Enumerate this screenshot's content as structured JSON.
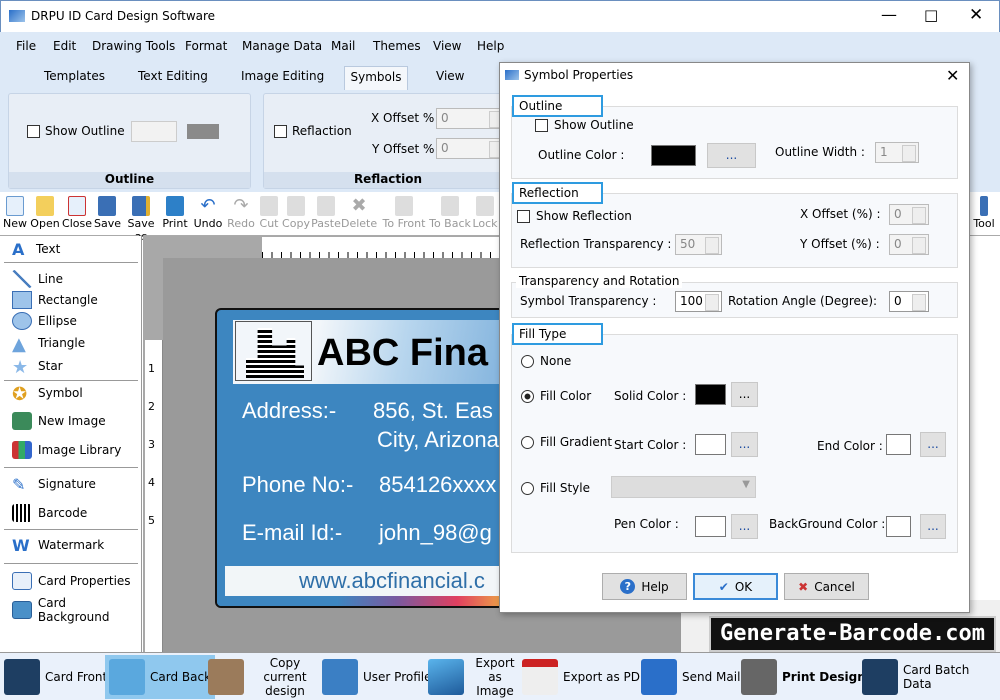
{
  "window": {
    "title": "DRPU ID Card Design Software",
    "controls": [
      "minimize",
      "maximize",
      "close"
    ]
  },
  "menu": [
    "File",
    "Edit",
    "Drawing Tools",
    "Format",
    "Manage Data",
    "Mail",
    "Themes",
    "View",
    "Help"
  ],
  "tabs": {
    "items": [
      "Templates",
      "Text Editing",
      "Image Editing",
      "Symbols",
      "View"
    ],
    "active": "Symbols"
  },
  "ribbon": {
    "outline": {
      "checkbox": "Show Outline",
      "group_label": "Outline"
    },
    "reflaction": {
      "checkbox": "Reflaction",
      "x_label": "X Offset %",
      "x_value": "0",
      "y_label": "Y Offset %",
      "y_value": "0",
      "group_label": "Reflaction"
    }
  },
  "toolbar": [
    "New",
    "Open",
    "Close",
    "Save",
    "Save as",
    "Print",
    "Undo",
    "Redo",
    "Cut",
    "Copy",
    "Paste",
    "Delete",
    "To Front",
    "To Back",
    "Lock"
  ],
  "toolbar_right": "Tool",
  "left_panel": [
    "Text",
    "Line",
    "Rectangle",
    "Ellipse",
    "Triangle",
    "Star",
    "Symbol",
    "New Image",
    "Image Library",
    "Signature",
    "Barcode",
    "Watermark",
    "Card Properties",
    "Card Background"
  ],
  "ruler": {
    "left": [
      "1",
      "2",
      "3",
      "4",
      "5"
    ]
  },
  "card": {
    "company": "ABC Fina",
    "address_label": "Address:-",
    "address_1": "856, St. Eas",
    "address_2": "City, Arizona",
    "phone_label": "Phone No:-",
    "phone": "854126xxxx",
    "email_label": "E-mail Id:-",
    "email": "john_98@g",
    "website": "www.abcfinancial.c",
    "color": "#3d86c0"
  },
  "dialog": {
    "title": "Symbol Properties",
    "outline": {
      "legend": "Outline",
      "show": "Show Outline",
      "color_label": "Outline Color :",
      "color": "#000000",
      "dots": "...",
      "width_label": "Outline Width :",
      "width": "1"
    },
    "reflection": {
      "legend": "Reflection",
      "show": "Show Reflection",
      "x_label": "X Offset (%) :",
      "x": "0",
      "transparency_label": "Reflection Transparency :",
      "transparency": "50",
      "y_label": "Y Offset (%) :",
      "y": "0"
    },
    "transrot": {
      "legend": "Transparency and Rotation",
      "sym_label": "Symbol Transparency :",
      "sym": "100",
      "rot_label": "Rotation Angle (Degree):",
      "rot": "0"
    },
    "fill": {
      "legend": "Fill Type",
      "none": "None",
      "fill_color": "Fill Color",
      "solid_label": "Solid Color :",
      "solid": "#000000",
      "fill_gradient": "Fill Gradient",
      "start_label": "Start Color :",
      "end_label": "End Color :",
      "fill_style": "Fill Style",
      "pen_label": "Pen Color :",
      "bg_label": "BackGround Color :",
      "selected": "Fill Color",
      "dots": "..."
    },
    "buttons": {
      "help": "Help",
      "ok": "OK",
      "cancel": "Cancel"
    },
    "highlight_color": "#2e9be0"
  },
  "watermark": "Generate-Barcode.com",
  "bottom": [
    "Card Front",
    "Card Back",
    "Copy current design",
    "User Profile",
    "Export as Image",
    "Export as PDF",
    "Send Mail",
    "Print Design",
    "Card Batch Data"
  ],
  "bottom_active": "Card Back"
}
